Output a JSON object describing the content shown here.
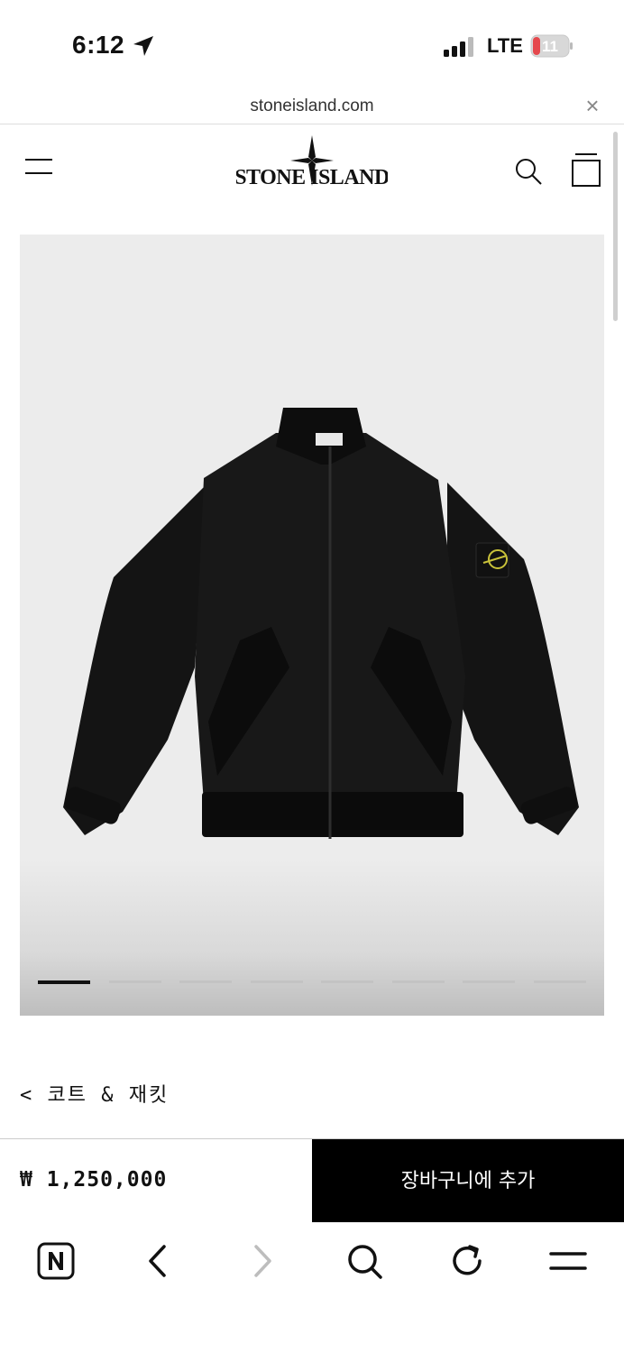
{
  "status_bar": {
    "time": "6:12",
    "network": "LTE",
    "battery_level": "11",
    "icons": [
      "location-arrow-icon",
      "signal-bars-icon",
      "battery-icon"
    ]
  },
  "browser": {
    "url": "stoneisland.com",
    "close_icon": "close-icon",
    "close_glyph": "×",
    "toolbar_icons": [
      "naver-n-icon",
      "back-arrow-icon",
      "forward-arrow-icon",
      "search-icon",
      "reload-icon",
      "menu-icon"
    ]
  },
  "header": {
    "logo_text": "STONE ISLAND",
    "icons": [
      "hamburger-menu-icon",
      "search-icon",
      "shopping-bag-icon"
    ]
  },
  "product": {
    "image_alt": "black jacket with compass badge on sleeve",
    "carousel_count": 8,
    "carousel_active_index": 0,
    "breadcrumb": "< 코트 & 재킷",
    "price": "₩ 1,250,000",
    "add_to_cart_label": "장바구니에 추가"
  },
  "colors": {
    "background": "#ffffff",
    "button": "#000000",
    "button_text": "#ffffff",
    "image_bg": "#ececec",
    "accent_badge": "#c9c23a"
  }
}
